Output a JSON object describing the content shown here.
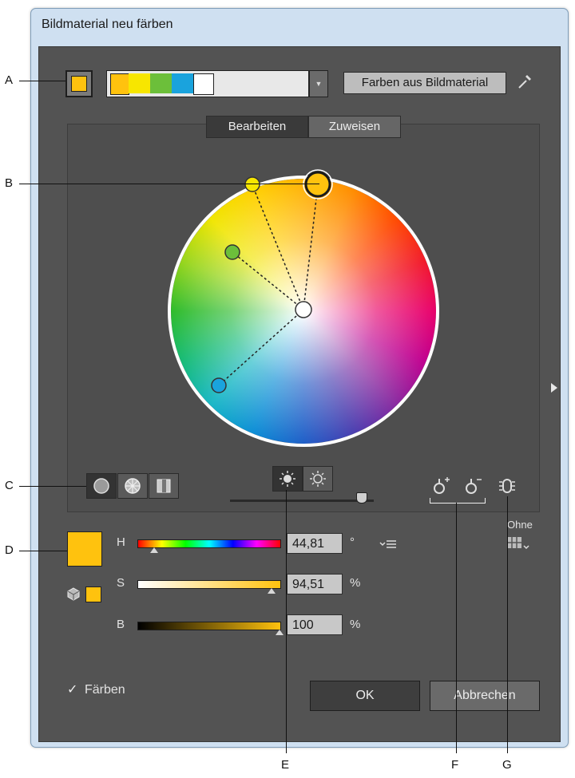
{
  "window": {
    "title": "Bildmaterial neu färben"
  },
  "top_bar": {
    "from_artwork_button": "Farben aus Bildmaterial",
    "palette_swatches": [
      "#ffc20e",
      "#f7e600",
      "#6cbf3a",
      "#1aa3dd",
      "#ffffff"
    ]
  },
  "tabs": [
    {
      "label": "Bearbeiten",
      "active": true
    },
    {
      "label": "Zuweisen",
      "active": false
    }
  ],
  "hsb": {
    "h": {
      "label": "H",
      "value": "44,81",
      "unit": "°",
      "fraction": 0.12
    },
    "s": {
      "label": "S",
      "value": "94,51",
      "unit": "%",
      "fraction": 0.945
    },
    "b": {
      "label": "B",
      "value": "100",
      "unit": "%",
      "fraction": 1.0
    }
  },
  "current_color": "#ffc20e",
  "limit_menu": {
    "label": "Ohne"
  },
  "recolor_checkbox": {
    "label": "Färben",
    "checked": true
  },
  "buttons": {
    "ok": "OK",
    "cancel": "Abbrechen"
  },
  "callouts": {
    "a": "A",
    "b": "B",
    "c": "C",
    "d": "D",
    "e": "E",
    "f": "F",
    "g": "G"
  },
  "icons": [
    "eyedropper-icon",
    "smooth-wheel-icon",
    "segmented-wheel-icon",
    "color-bars-icon",
    "brightness-icon",
    "saturation-icon",
    "add-color-tool-icon",
    "remove-color-tool-icon",
    "link-harmony-icon",
    "limit-grid-icon",
    "menu-icon",
    "3d-cube-icon",
    "chevron-right-icon"
  ]
}
